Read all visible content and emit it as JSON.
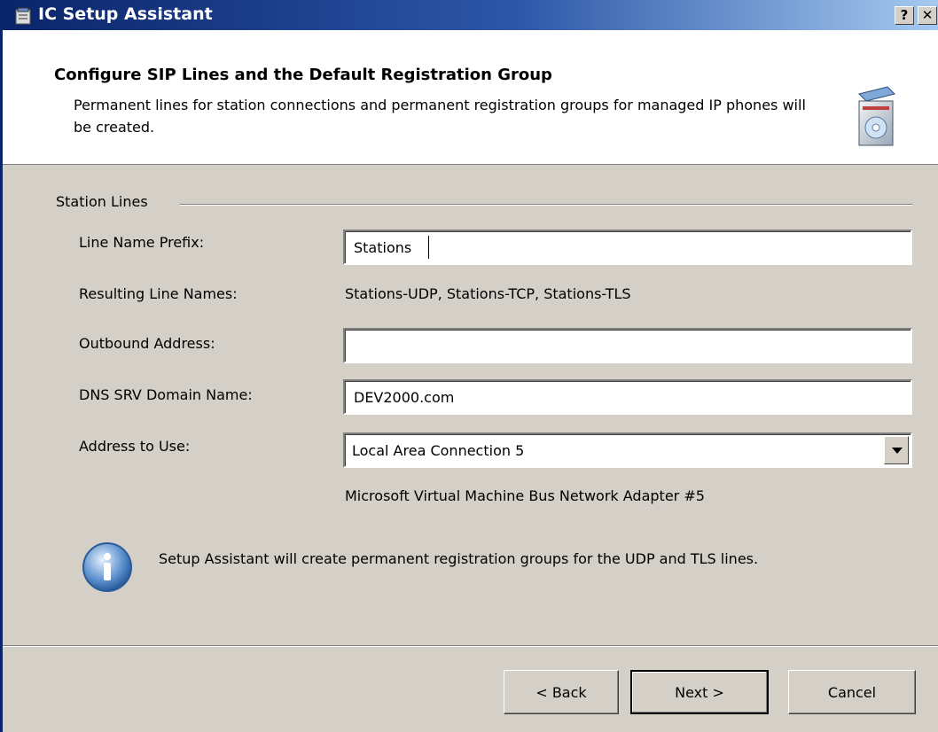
{
  "window": {
    "title": "IC Setup Assistant",
    "help_button": "?",
    "close_button": "✕"
  },
  "header": {
    "title": "Configure SIP Lines and the Default Registration Group",
    "description": "Permanent lines for station connections and permanent registration groups for managed IP phones will be created."
  },
  "station_lines": {
    "group_label": "Station Lines",
    "line_name_prefix": {
      "label": "Line Name Prefix:",
      "value": "Stations"
    },
    "resulting_line_names": {
      "label": "Resulting Line Names:",
      "value": "Stations-UDP, Stations-TCP, Stations-TLS"
    },
    "outbound_address": {
      "label": "Outbound Address:",
      "value": ""
    },
    "dns_srv_domain": {
      "label": "DNS SRV Domain Name:",
      "value": "DEV2000.com"
    },
    "address_to_use": {
      "label": "Address to Use:",
      "selected": "Local Area Connection 5",
      "adapter": "Microsoft Virtual Machine Bus Network Adapter #5"
    }
  },
  "info": {
    "message": "Setup Assistant will create permanent registration groups for the UDP and TLS lines."
  },
  "buttons": {
    "back": "< Back",
    "next": "Next >",
    "cancel": "Cancel"
  },
  "colors": {
    "titlebar_start": "#0a246a",
    "titlebar_end": "#a6caf0",
    "dialog_bg": "#d4d0c8",
    "header_bg": "#ffffff"
  }
}
